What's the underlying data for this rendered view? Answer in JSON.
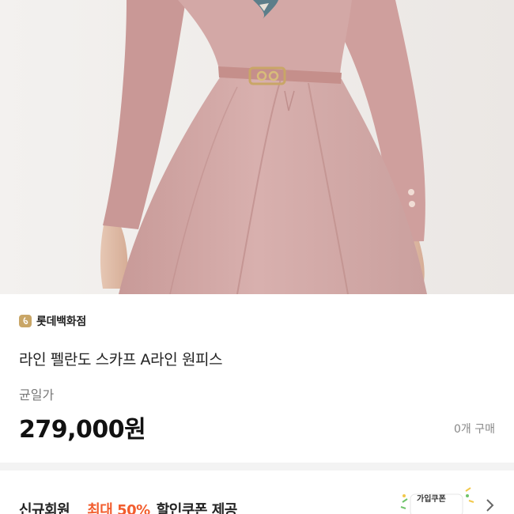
{
  "store": {
    "name": "롯데백화점",
    "logo_icon": "lotte-logo-icon",
    "logo_color": "#c9a667"
  },
  "product": {
    "title": "라인 펠란도 스카프 A라인 원피스",
    "price_label": "균일가",
    "price": "279,000원",
    "purchase_count": "0개 구매"
  },
  "coupon_banner": {
    "member_label": "신규회원",
    "max_discount": "최대 50%",
    "description": "할인쿠폰 제공",
    "image_label": "가입쿠폰",
    "accent_color": "#f25d2e",
    "chevron_icon": "chevron-right-icon"
  }
}
